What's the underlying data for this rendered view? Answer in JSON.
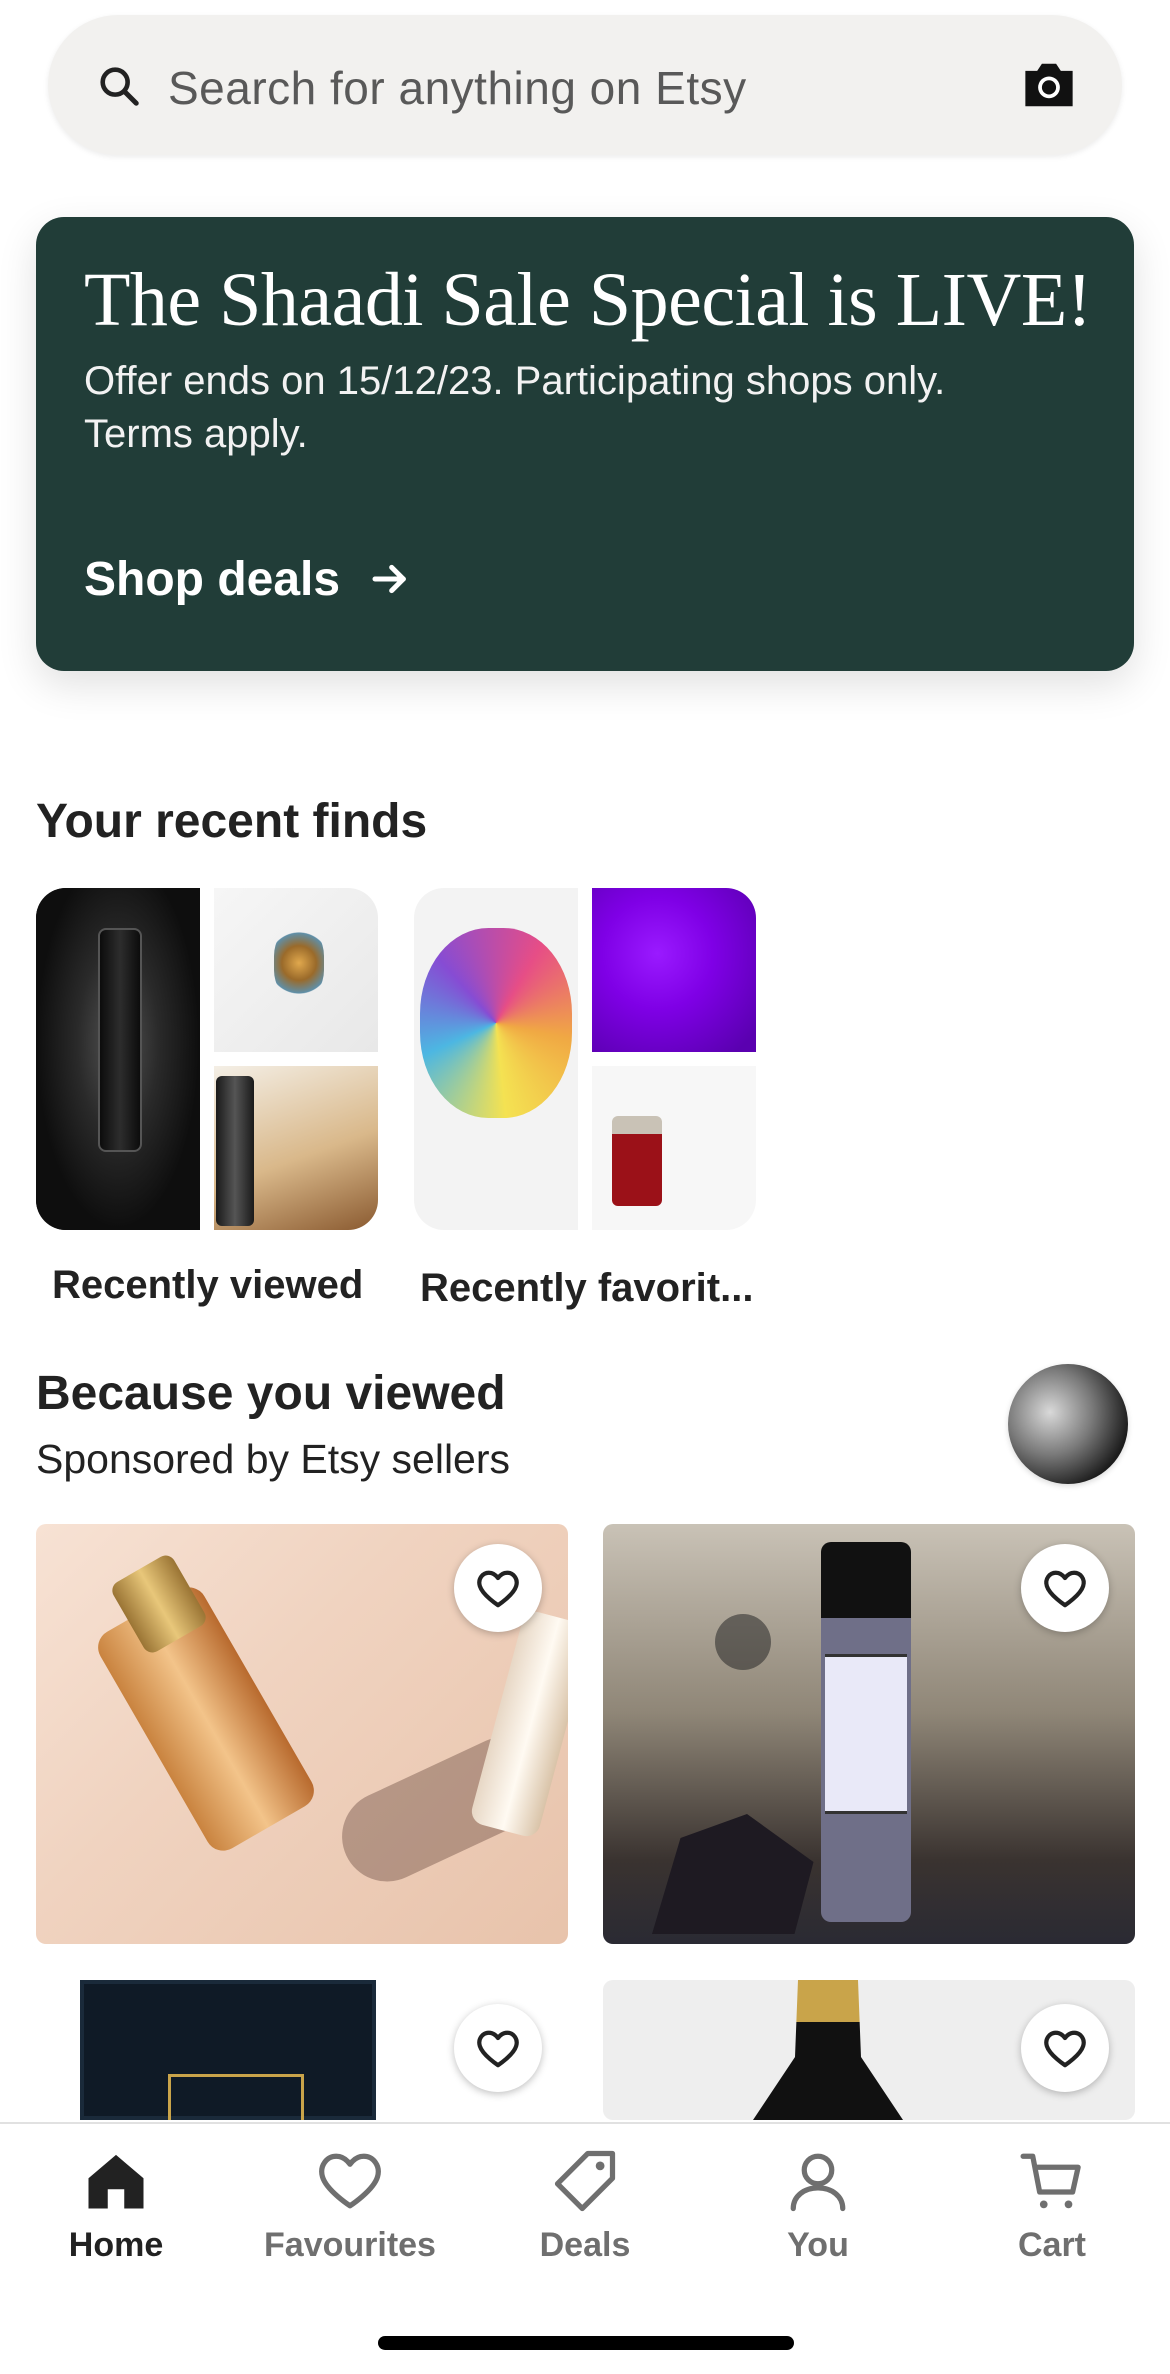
{
  "search": {
    "placeholder": "Search for anything on Etsy"
  },
  "banner": {
    "title": "The Shaadi Sale Special is LIVE!",
    "subtitle": "Offer ends on 15/12/23. Participating shops only. Terms apply.",
    "cta": "Shop deals",
    "background": "#213d38"
  },
  "recent_finds": {
    "title": "Your recent finds",
    "collections": [
      {
        "label": "Recently viewed"
      },
      {
        "label": "Recently favorit..."
      }
    ]
  },
  "because_you_viewed": {
    "title": "Because you viewed",
    "subtitle": "Sponsored by Etsy sellers"
  },
  "products": [
    {
      "image": "mermaid-moon-perfume-roller",
      "favourited": false
    },
    {
      "image": "protection-oil-roller-bottle",
      "favourited": false
    },
    {
      "image": "dark-perfume-box",
      "favourited": false
    },
    {
      "image": "black-perfume-bottle-gold-cap",
      "favourited": false
    }
  ],
  "bottom_nav": {
    "items": [
      {
        "label": "Home",
        "icon": "home-icon",
        "active": true
      },
      {
        "label": "Favourites",
        "icon": "heart-icon",
        "active": false
      },
      {
        "label": "Deals",
        "icon": "tag-icon",
        "active": false
      },
      {
        "label": "You",
        "icon": "person-icon",
        "active": false
      },
      {
        "label": "Cart",
        "icon": "cart-icon",
        "active": false
      }
    ]
  }
}
